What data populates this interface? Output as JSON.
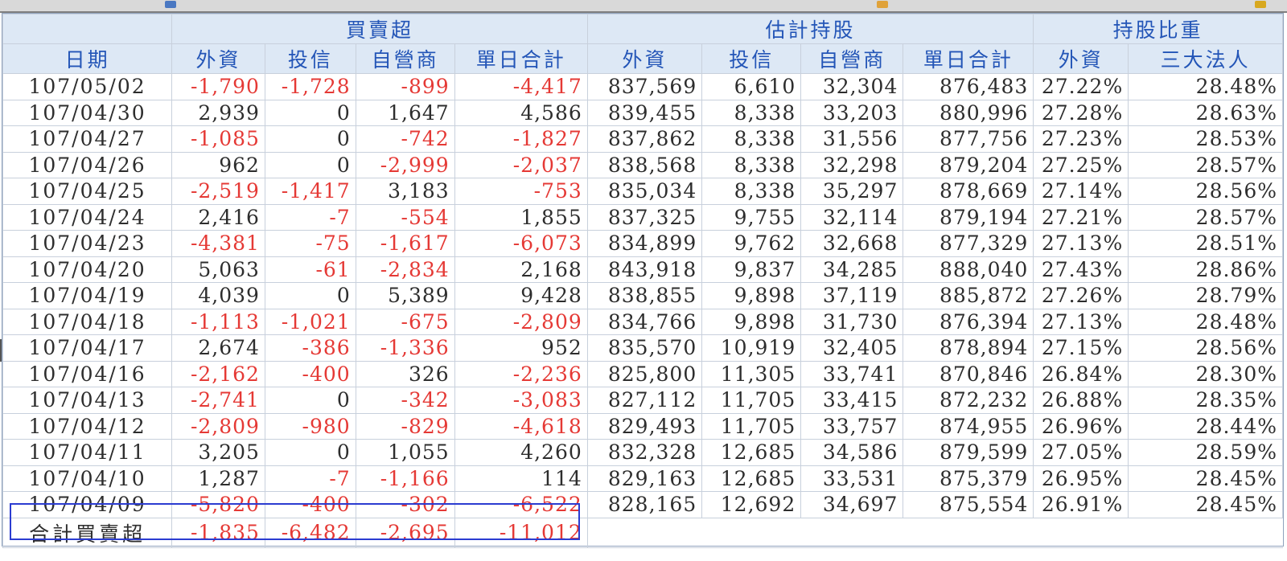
{
  "colors": {
    "header_bg": "#dde8f5",
    "header_text": "#2355b7",
    "negative": "#e53935",
    "highlight_box": "#2b3cd1"
  },
  "header": {
    "groups": [
      "買賣超",
      "估計持股",
      "持股比重"
    ],
    "columns": [
      "日期",
      "外資",
      "投信",
      "自營商",
      "單日合計",
      "外資",
      "投信",
      "自營商",
      "單日合計",
      "外資",
      "三大法人"
    ]
  },
  "rows": [
    [
      "107/05/02",
      "-1,790",
      "-1,728",
      "-899",
      "-4,417",
      "837,569",
      "6,610",
      "32,304",
      "876,483",
      "27.22%",
      "28.48%"
    ],
    [
      "107/04/30",
      "2,939",
      "0",
      "1,647",
      "4,586",
      "839,455",
      "8,338",
      "33,203",
      "880,996",
      "27.28%",
      "28.63%"
    ],
    [
      "107/04/27",
      "-1,085",
      "0",
      "-742",
      "-1,827",
      "837,862",
      "8,338",
      "31,556",
      "877,756",
      "27.23%",
      "28.53%"
    ],
    [
      "107/04/26",
      "962",
      "0",
      "-2,999",
      "-2,037",
      "838,568",
      "8,338",
      "32,298",
      "879,204",
      "27.25%",
      "28.57%"
    ],
    [
      "107/04/25",
      "-2,519",
      "-1,417",
      "3,183",
      "-753",
      "835,034",
      "8,338",
      "35,297",
      "878,669",
      "27.14%",
      "28.56%"
    ],
    [
      "107/04/24",
      "2,416",
      "-7",
      "-554",
      "1,855",
      "837,325",
      "9,755",
      "32,114",
      "879,194",
      "27.21%",
      "28.57%"
    ],
    [
      "107/04/23",
      "-4,381",
      "-75",
      "-1,617",
      "-6,073",
      "834,899",
      "9,762",
      "32,668",
      "877,329",
      "27.13%",
      "28.51%"
    ],
    [
      "107/04/20",
      "5,063",
      "-61",
      "-2,834",
      "2,168",
      "843,918",
      "9,837",
      "34,285",
      "888,040",
      "27.43%",
      "28.86%"
    ],
    [
      "107/04/19",
      "4,039",
      "0",
      "5,389",
      "9,428",
      "838,855",
      "9,898",
      "37,119",
      "885,872",
      "27.26%",
      "28.79%"
    ],
    [
      "107/04/18",
      "-1,113",
      "-1,021",
      "-675",
      "-2,809",
      "834,766",
      "9,898",
      "31,730",
      "876,394",
      "27.13%",
      "28.48%"
    ],
    [
      "107/04/17",
      "2,674",
      "-386",
      "-1,336",
      "952",
      "835,570",
      "10,919",
      "32,405",
      "878,894",
      "27.15%",
      "28.56%"
    ],
    [
      "107/04/16",
      "-2,162",
      "-400",
      "326",
      "-2,236",
      "825,800",
      "11,305",
      "33,741",
      "870,846",
      "26.84%",
      "28.30%"
    ],
    [
      "107/04/13",
      "-2,741",
      "0",
      "-342",
      "-3,083",
      "827,112",
      "11,705",
      "33,415",
      "872,232",
      "26.88%",
      "28.35%"
    ],
    [
      "107/04/12",
      "-2,809",
      "-980",
      "-829",
      "-4,618",
      "829,493",
      "11,705",
      "33,757",
      "874,955",
      "26.96%",
      "28.44%"
    ],
    [
      "107/04/11",
      "3,205",
      "0",
      "1,055",
      "4,260",
      "832,328",
      "12,685",
      "34,586",
      "879,599",
      "27.05%",
      "28.59%"
    ],
    [
      "107/04/10",
      "1,287",
      "-7",
      "-1,166",
      "114",
      "829,163",
      "12,685",
      "33,531",
      "875,379",
      "26.95%",
      "28.45%"
    ],
    [
      "107/04/09",
      "-5,820",
      "-400",
      "-302",
      "-6,522",
      "828,165",
      "12,692",
      "34,697",
      "875,554",
      "26.91%",
      "28.45%"
    ]
  ],
  "total": {
    "label": "合計買賣超",
    "values": [
      "-1,835",
      "-6,482",
      "-2,695",
      "-11,012"
    ]
  }
}
